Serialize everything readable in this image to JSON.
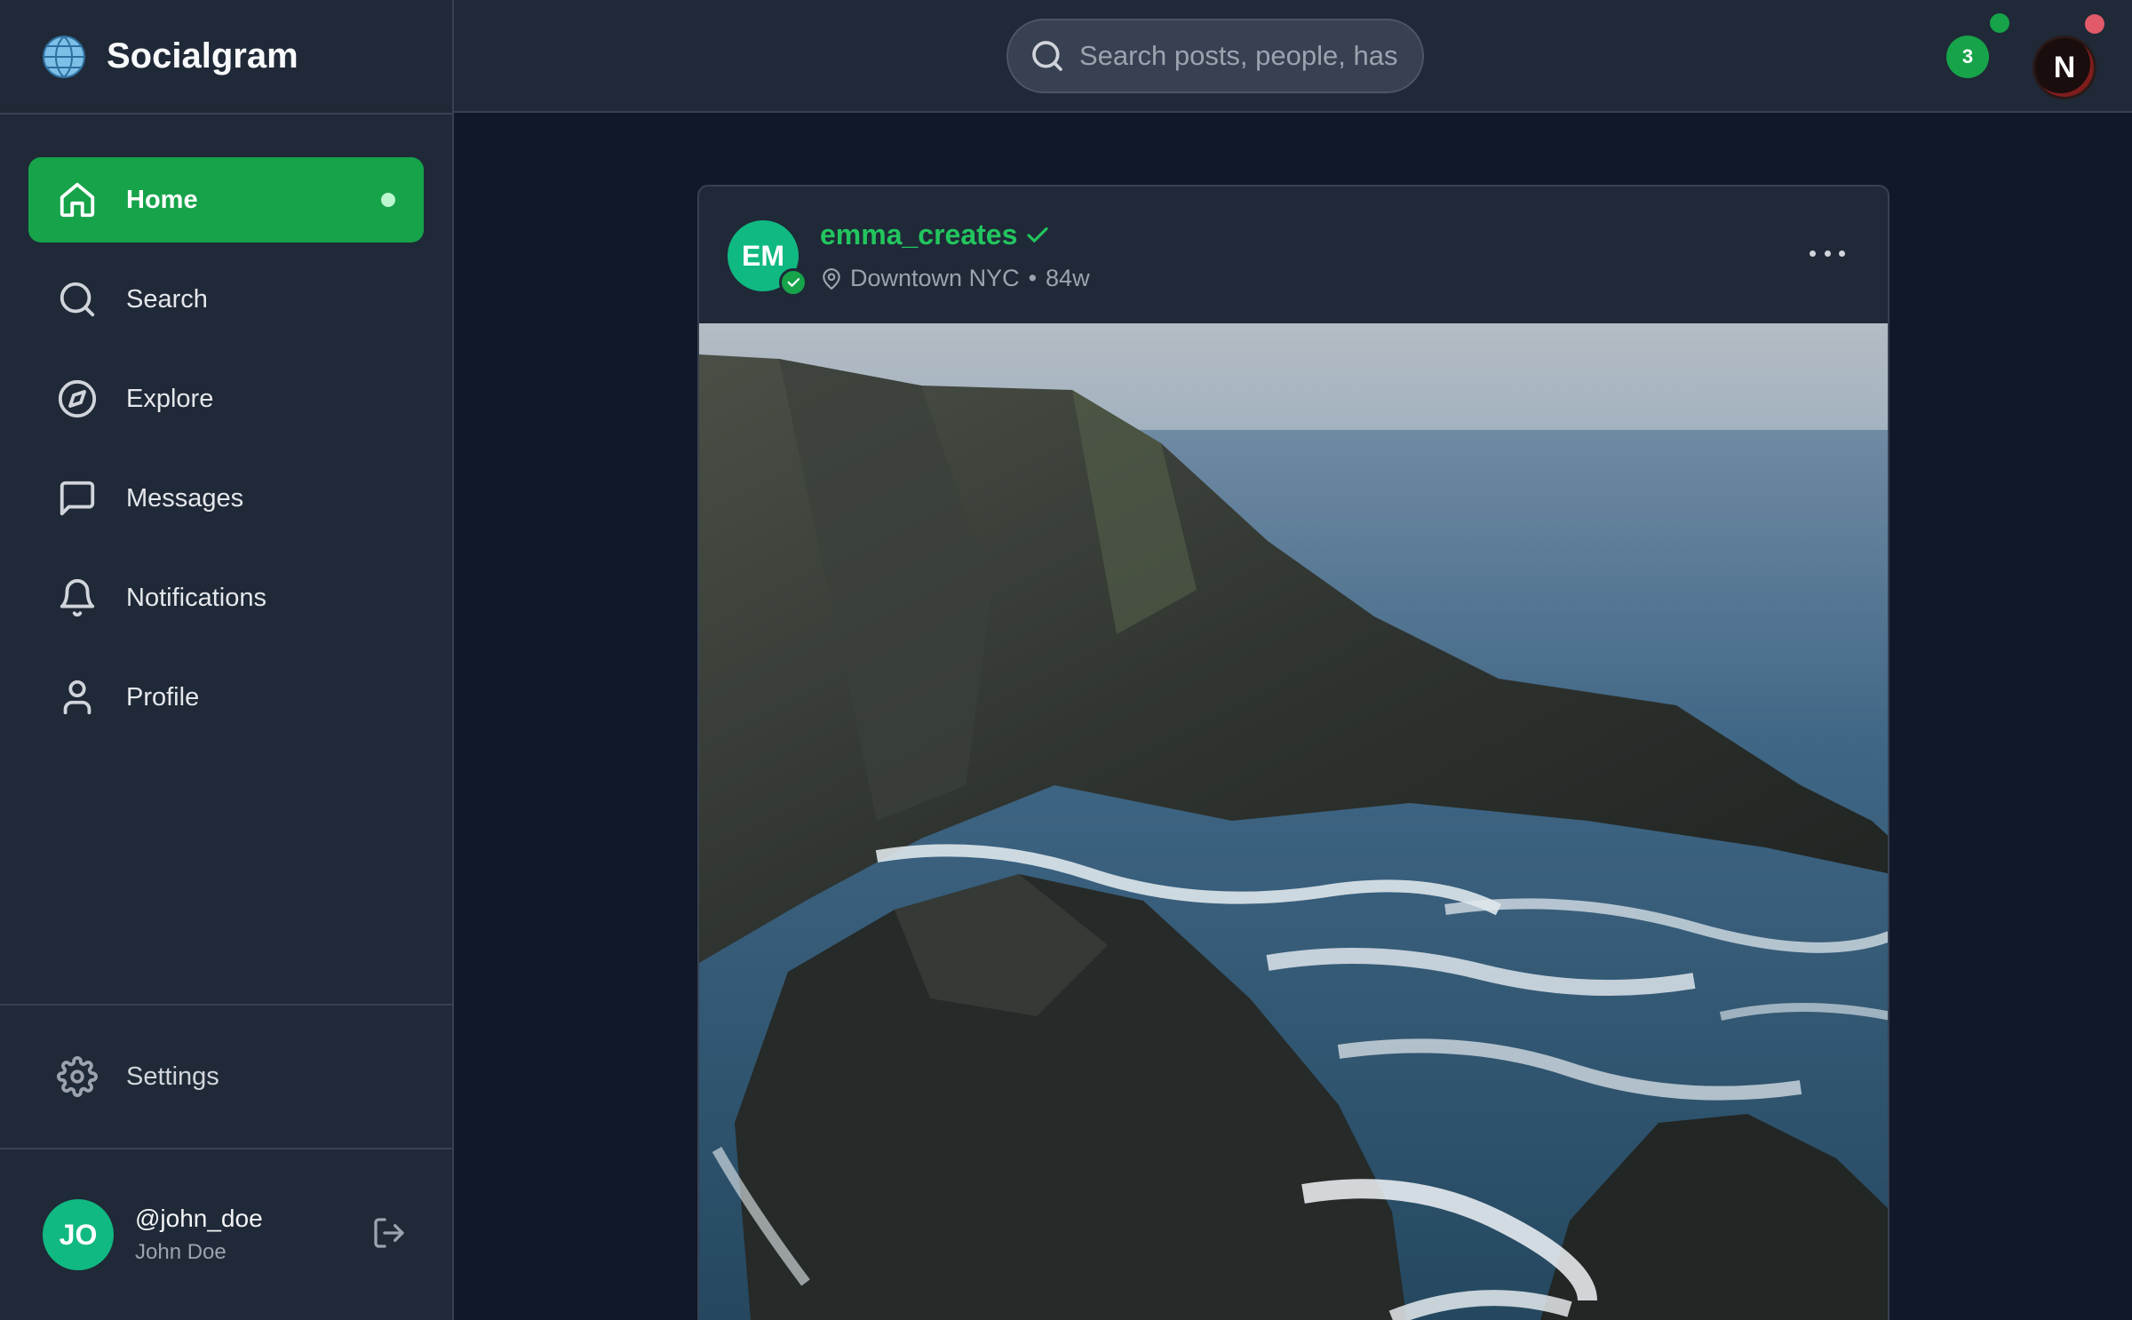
{
  "app": {
    "name": "Socialgram"
  },
  "sidebar": {
    "items": [
      {
        "label": "Home",
        "icon": "home-icon",
        "active": true
      },
      {
        "label": "Search",
        "icon": "search-icon",
        "active": false
      },
      {
        "label": "Explore",
        "icon": "compass-icon",
        "active": false
      },
      {
        "label": "Messages",
        "icon": "message-icon",
        "active": false
      },
      {
        "label": "Notifications",
        "icon": "bell-icon",
        "active": false
      },
      {
        "label": "Profile",
        "icon": "user-icon",
        "active": false
      }
    ],
    "settings_label": "Settings",
    "user": {
      "initials": "JO",
      "handle": "@john_doe",
      "name": "John Doe"
    }
  },
  "topbar": {
    "search_placeholder": "Search posts, people, hashtags...",
    "notification_count": "3",
    "profile_initial": "N"
  },
  "post": {
    "avatar_initials": "EM",
    "username": "emma_creates",
    "location": "Downtown NYC",
    "age": "84w",
    "image": "coastal-cliffs-photo"
  },
  "colors": {
    "accent": "#16a34a",
    "accent_text": "#22c55e",
    "avatar": "#10b981",
    "sidebar_bg": "#1f2937",
    "page_bg": "#111827"
  }
}
